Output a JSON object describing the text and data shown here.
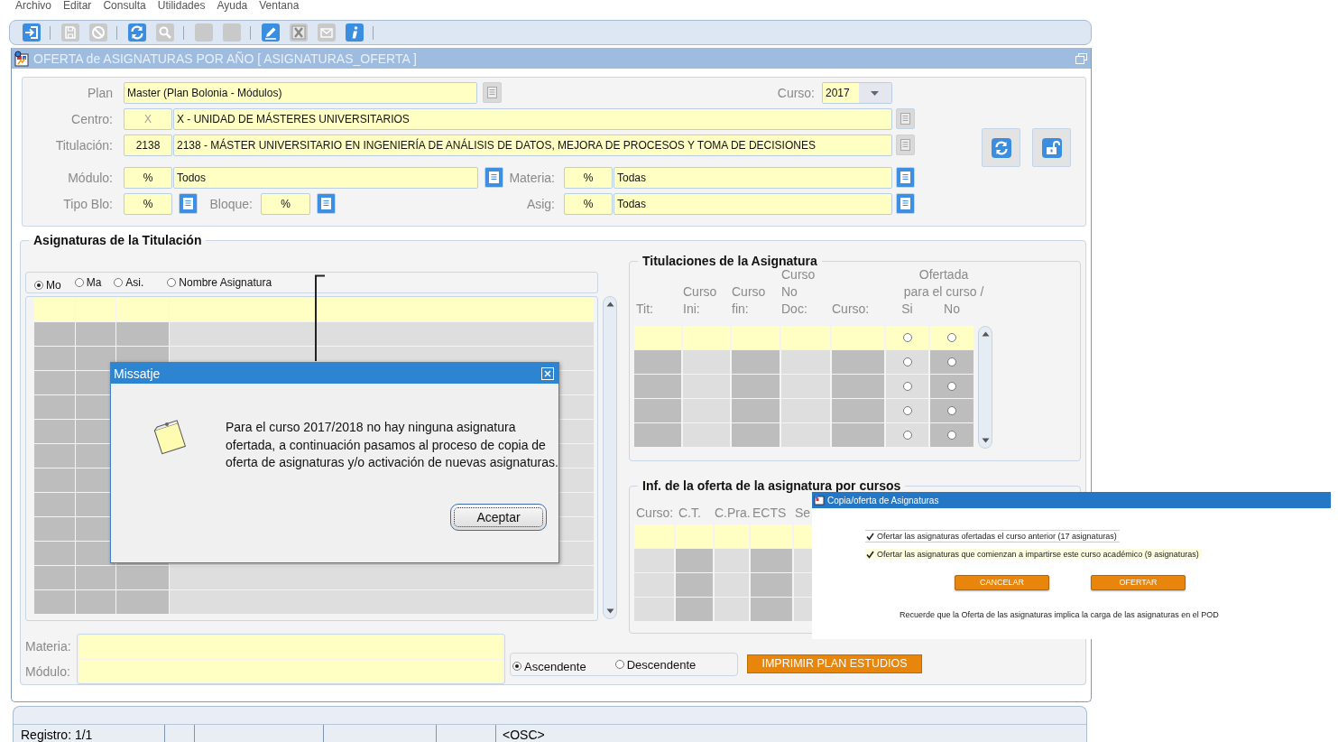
{
  "menu": [
    "Archivo",
    "Editar",
    "Consulta",
    "Utilidades",
    "Ayuda",
    "Ventana"
  ],
  "toolbar": [
    [
      {
        "kind": "exit",
        "disabled": false
      }
    ],
    [
      {
        "kind": "save",
        "disabled": true
      },
      {
        "kind": "cancel",
        "disabled": true
      }
    ],
    [
      {
        "kind": "refresh",
        "disabled": false
      },
      {
        "kind": "search",
        "disabled": true
      }
    ],
    [
      {
        "kind": "blank",
        "disabled": true
      },
      {
        "kind": "blank",
        "disabled": true
      }
    ],
    [
      {
        "kind": "edit",
        "disabled": false
      },
      {
        "kind": "excel",
        "disabled": true
      },
      {
        "kind": "mail",
        "disabled": true
      },
      {
        "kind": "info",
        "disabled": false
      }
    ]
  ],
  "window": {
    "title": "OFERTA de ASIGNATURAS POR AÑO [ ASIGNATURAS_OFERTA ]"
  },
  "filters": {
    "plan": {
      "label": "Plan",
      "value": "Master (Plan Bolonia - Módulos)",
      "lov_disabled": true
    },
    "curso": {
      "label": "Curso:",
      "value": "2017"
    },
    "centro": {
      "label": "Centro:",
      "code": "X",
      "code_disabled": true,
      "value": "X - UNIDAD DE MÁSTERES UNIVERSITARIOS",
      "lov_disabled": true
    },
    "titulacion": {
      "label": "Titulación:",
      "code": "2138",
      "code_disabled": false,
      "value": "2138 - MÁSTER UNIVERSITARIO EN INGENIERÍA DE ANÁLISIS DE DATOS, MEJORA DE PROCESOS Y TOMA DE DECISIONES",
      "lov_disabled": true
    },
    "modulo": {
      "label": "Módulo:",
      "code": "%",
      "value": "Todos",
      "lov_disabled": false
    },
    "materia": {
      "label": "Materia:",
      "code": "%",
      "value": "Todas",
      "lov_disabled": false
    },
    "tipo_blo": {
      "label": "Tipo Blo:",
      "code": "%",
      "lov_disabled": false
    },
    "bloque": {
      "label": "Bloque:",
      "code": "%",
      "lov_disabled": false
    },
    "asig": {
      "label": "Asig:",
      "code": "%",
      "value": "Todas",
      "lov_disabled": false
    }
  },
  "actions": [
    {
      "kind": "refresh"
    },
    {
      "kind": "unlock"
    }
  ],
  "asignaturas": {
    "title": "Asignaturas de la Titulación",
    "order_by": [
      {
        "label": "Mo",
        "selected": true
      },
      {
        "label": "Ma",
        "selected": false
      },
      {
        "label": "Asi.",
        "selected": false
      },
      {
        "label": "Nombre Asignatura",
        "selected": false
      }
    ],
    "rows": [
      {
        "selected": true
      },
      {
        "selected": false
      },
      {
        "selected": false
      },
      {
        "selected": false
      },
      {
        "selected": false
      },
      {
        "selected": false
      },
      {
        "selected": false
      },
      {
        "selected": false
      },
      {
        "selected": false
      },
      {
        "selected": false
      },
      {
        "selected": false
      },
      {
        "selected": false
      },
      {
        "selected": false
      }
    ],
    "materia_label": "Materia:",
    "modulo_label": "Módulo:",
    "sort": [
      {
        "label": "Ascendente",
        "selected": true
      },
      {
        "label": "Descendente",
        "selected": false
      }
    ],
    "print_button": "IMPRIMIR PLAN ESTUDIOS"
  },
  "titulaciones": {
    "title": "Titulaciones de la Asignatura",
    "columns": [
      "Tit:",
      "Curso\nIni:",
      "Curso\nfin:",
      "Curso\nNo\nDoc:",
      "Curso:"
    ],
    "offer_header": "Ofertada\npara el curso /",
    "offer_columns": [
      "Si",
      "No"
    ],
    "rows": [
      {
        "selected": true,
        "si": false,
        "no": false
      },
      {
        "selected": false,
        "si": false,
        "no": false
      },
      {
        "selected": false,
        "si": false,
        "no": false
      },
      {
        "selected": false,
        "si": false,
        "no": false
      },
      {
        "selected": false,
        "si": false,
        "no": false
      }
    ]
  },
  "oferta_cursos": {
    "title": "Inf. de la oferta de la asignatura por cursos",
    "columns": [
      "Curso:",
      "C.T.",
      "C.Pra.",
      "ECTS",
      "Se"
    ],
    "rows": [
      {
        "selected": true
      },
      {
        "selected": false
      },
      {
        "selected": false
      },
      {
        "selected": false
      }
    ]
  },
  "message_dialog": {
    "title": "Missatje",
    "text": "Para el curso 2017/2018 no hay ninguna asignatura ofertada, a continuación pasamos al proceso de copia de oferta de asignaturas y/o activación de nuevas asignaturas.",
    "button": "Aceptar"
  },
  "copy_dialog": {
    "title": "Copia/oferta de Asignaturas",
    "options": [
      {
        "label": "Ofertar las asignaturas ofertadas el curso anterior (17 asignaturas)",
        "checked": true
      },
      {
        "label": "Ofertar las asignaturas que comienzan a impartirse este curso académico (9 asignaturas)",
        "checked": true
      }
    ],
    "buttons": [
      "CANCELAR",
      "OFERTAR"
    ],
    "note": "Recuerde que la Oferta de las asignaturas implica la carga de las asignaturas en el POD"
  },
  "status_bar": {
    "record": "Registro: 1/1",
    "mode": "<OSC>"
  }
}
